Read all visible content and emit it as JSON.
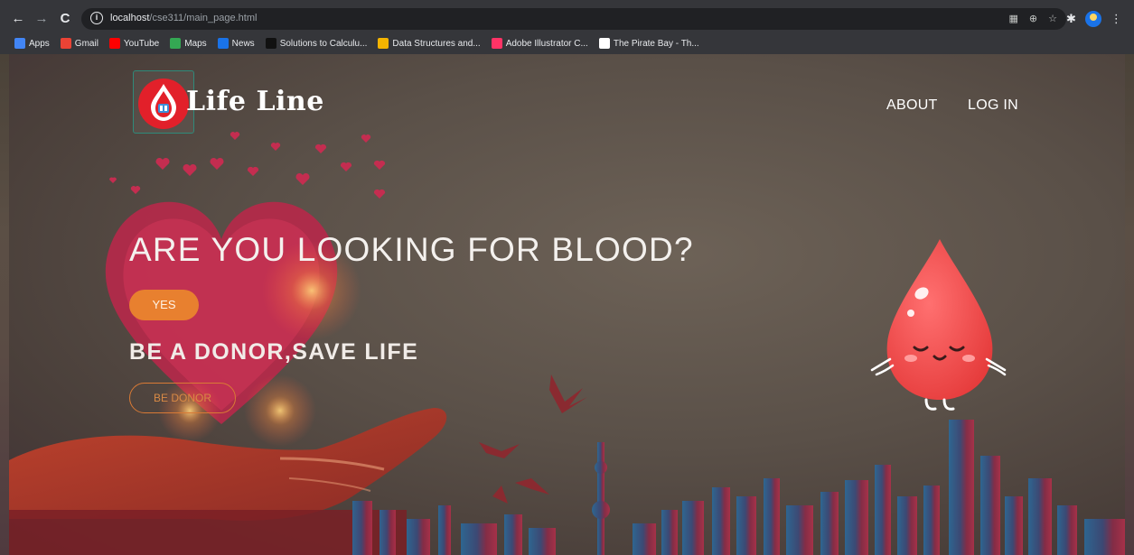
{
  "browser": {
    "nav": {
      "back": "←",
      "forward": "→",
      "reload": "C"
    },
    "url": {
      "host": "localhost",
      "path": "/cse311/main_page.html"
    },
    "bookmarks": [
      {
        "label": "Apps",
        "color": "#4285f4"
      },
      {
        "label": "Gmail",
        "color": "#ea4335"
      },
      {
        "label": "YouTube",
        "color": "#ff0000"
      },
      {
        "label": "Maps",
        "color": "#34a853"
      },
      {
        "label": "News",
        "color": "#1a73e8"
      },
      {
        "label": "Solutions to Calculu...",
        "color": "#111111"
      },
      {
        "label": "Data Structures and...",
        "color": "#f4b400"
      },
      {
        "label": "Adobe Illustrator C...",
        "color": "#ff3366"
      },
      {
        "label": "The Pirate Bay - Th...",
        "color": "#ffffff"
      }
    ]
  },
  "site": {
    "logo": {
      "word1": "Life",
      "word2": "Line"
    },
    "nav": {
      "about": "ABOUT",
      "login": "LOG IN"
    },
    "hero": {
      "headline": "ARE YOU LOOKING FOR BLOOD?",
      "yes_label": "YES",
      "subheadline": "BE A DONOR,SAVE LIFE",
      "donor_label": "BE DONOR"
    }
  },
  "colors": {
    "accent_orange": "#e8802f",
    "blood_red": "#ee4b4b",
    "chrome_dark": "#35363a"
  }
}
